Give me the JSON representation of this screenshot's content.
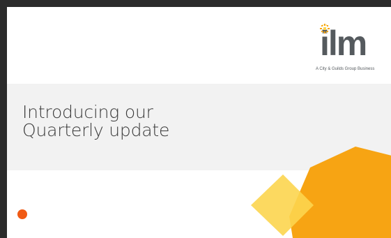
{
  "slide": {
    "title_line1": "Introducing our",
    "title_line2": "Quarterly update"
  },
  "logo": {
    "wordmark": "ilm",
    "tagline": "A City & Guilds Group Business"
  },
  "colors": {
    "frame": "#2b2b2b",
    "band": "#f2f2f2",
    "text": "#3a3a3a",
    "orange": "#f7a413",
    "yellow": "#fcd54f",
    "dot": "#f05a14"
  }
}
